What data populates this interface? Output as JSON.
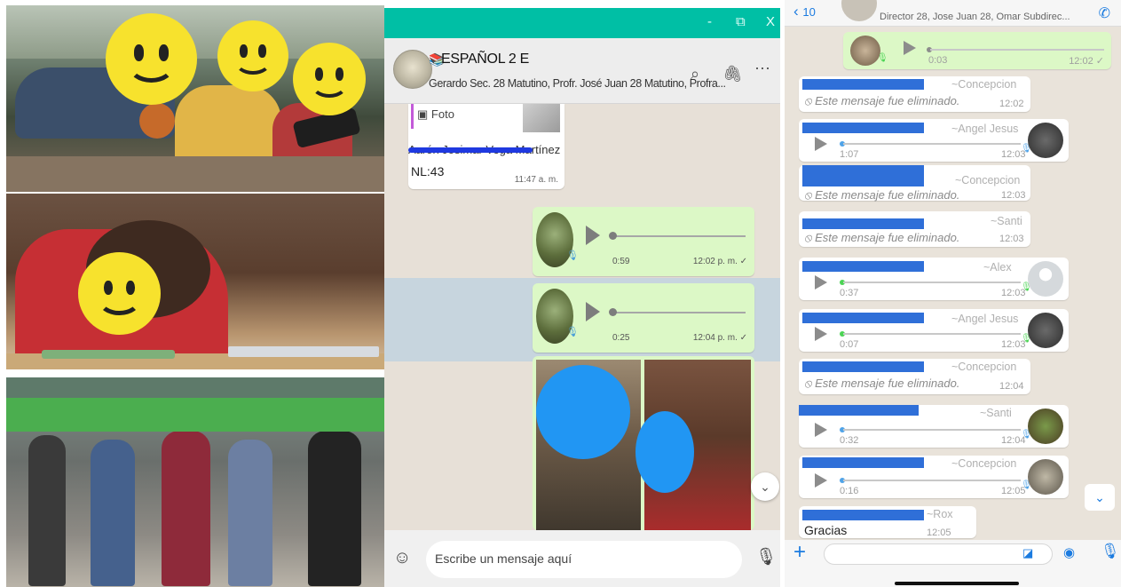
{
  "desktop": {
    "window_controls": {
      "minimize": "-",
      "restore": "⧉",
      "close": "X"
    },
    "group_name": "ESPAÑOL 2 E",
    "group_members": "Gerardo Sec. 28 Matutino, Profr. José Juan 28 Matutino, Profra...",
    "icons": {
      "search": "search-icon",
      "attach": "paperclip-icon",
      "menu": "more-icon"
    },
    "doc_message": {
      "label": "Foto",
      "student_line": "Aarón Josimar Vega Martínez",
      "nl": "NL:43",
      "time": "11:47 a. m."
    },
    "voice_messages": [
      {
        "duration": "0:59",
        "time": "12:02 p. m. ✓"
      },
      {
        "duration": "0:25",
        "time": "12:04 p. m. ✓"
      }
    ],
    "input_placeholder": "Escribe un mensaje aquí"
  },
  "mobile": {
    "back_label": "10",
    "members": "Director 28, Jose Juan 28, Omar Subdirec...",
    "top_voice": {
      "duration": "0:03",
      "time": "12:02 ✓"
    },
    "messages": [
      {
        "sender": "~Concepcion",
        "deleted_text": "Este mensaje fue eliminado.",
        "time": "12:02"
      },
      {
        "sender": "~Angel Jesus",
        "duration": "1:07",
        "time": "12:03"
      },
      {
        "sender": "~Concepcion",
        "deleted_text": "Este mensaje fue eliminado.",
        "time": "12:03"
      },
      {
        "sender": "~Santi",
        "deleted_text": "Este mensaje fue eliminado.",
        "time": "12:03"
      },
      {
        "sender": "~Alex",
        "duration": "0:37",
        "time": "12:03"
      },
      {
        "sender": "~Angel Jesus",
        "duration": "0:07",
        "time": "12:03"
      },
      {
        "sender": "~Concepcion",
        "deleted_text": "Este mensaje fue eliminado.",
        "time": "12:04"
      },
      {
        "sender": "~Santi",
        "duration": "0:32",
        "time": "12:04"
      },
      {
        "sender": "~Concepcion",
        "duration": "0:16",
        "time": "12:05"
      },
      {
        "sender": "~Rox",
        "text": "Gracias",
        "time": "12:05"
      }
    ]
  }
}
